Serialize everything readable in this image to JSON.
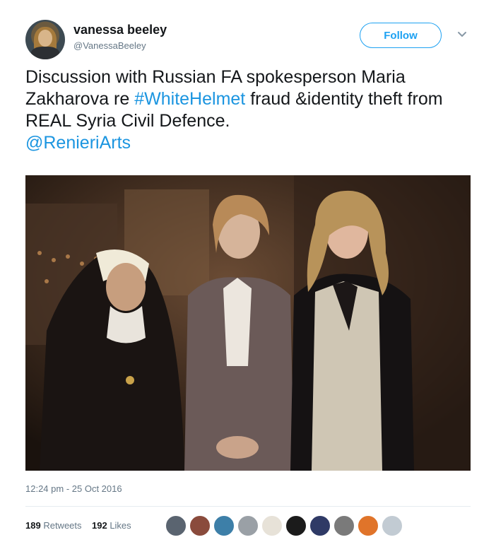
{
  "user": {
    "display_name": "vanessa beeley",
    "handle": "@VanessaBeeley"
  },
  "follow_label": "Follow",
  "tweet": {
    "text_before": "Discussion with Russian FA spokesperson Maria Zakharova re ",
    "hashtag": "#WhiteHelmet",
    "text_after": " fraud &identity theft from REAL Syria Civil Defence.",
    "mention": "@RenieriArts"
  },
  "timestamp": "12:24 pm - 25 Oct 2016",
  "stats": {
    "retweets_count": "189",
    "retweets_label": "Retweets",
    "likes_count": "192",
    "likes_label": "Likes"
  },
  "colors": {
    "accent": "#1da1f2",
    "link": "#1b95e0",
    "muted": "#657786"
  },
  "liker_avatars": [
    {
      "name": "liker-avatar-1",
      "color": "#5a6470"
    },
    {
      "name": "liker-avatar-2",
      "color": "#8a4b3c"
    },
    {
      "name": "liker-avatar-3",
      "color": "#3d7fa8"
    },
    {
      "name": "liker-avatar-4",
      "color": "#9aa0a6"
    },
    {
      "name": "liker-avatar-5",
      "color": "#e7e2d8"
    },
    {
      "name": "liker-avatar-6",
      "color": "#1b1b1b"
    },
    {
      "name": "liker-avatar-7",
      "color": "#2f3a66"
    },
    {
      "name": "liker-avatar-8",
      "color": "#7a7a7a"
    },
    {
      "name": "liker-avatar-9",
      "color": "#e0742a"
    },
    {
      "name": "liker-avatar-10",
      "color": "#c2cbd3"
    }
  ]
}
